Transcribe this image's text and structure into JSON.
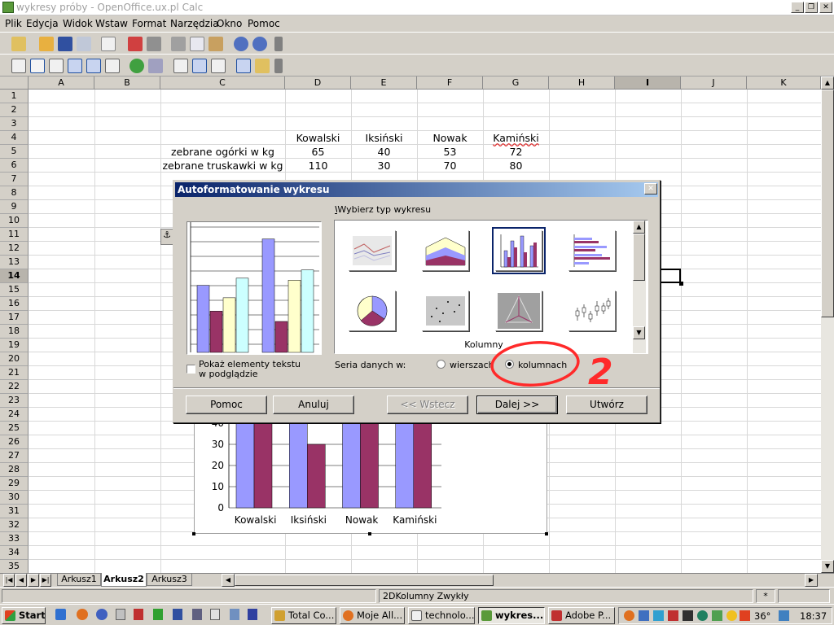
{
  "window": {
    "title": "wykresy próby - OpenOffice.ux.pl Calc"
  },
  "menu": [
    "Plik",
    "Edycja",
    "Widok",
    "Wstaw",
    "Format",
    "Narzędzia",
    "Okno",
    "Pomoc"
  ],
  "columns": [
    "A",
    "B",
    "C",
    "D",
    "E",
    "F",
    "G",
    "H",
    "I",
    "J",
    "K"
  ],
  "rows": [
    "1",
    "2",
    "3",
    "4",
    "5",
    "6",
    "7",
    "8",
    "9",
    "10",
    "11",
    "12",
    "13",
    "14",
    "15",
    "16",
    "17",
    "18",
    "19",
    "20",
    "21",
    "22",
    "23",
    "24",
    "25",
    "26",
    "27",
    "28",
    "29",
    "30",
    "31",
    "32",
    "33",
    "34",
    "35"
  ],
  "cells": {
    "d4": "Kowalski",
    "e4": "Iksiński",
    "f4": "Nowak",
    "g4": "Kamiński",
    "c5": "zebrane ogórki w kg",
    "d5": "65",
    "e5": "40",
    "f5": "53",
    "g5": "72",
    "c6": "zebrane truskawki w kg",
    "d6": "110",
    "e6": "30",
    "f6": "70",
    "g6": "80"
  },
  "dialog": {
    "title": "Autoformatowanie wykresu",
    "chart_type_label": "Wybierz typ wykresu",
    "selected_type_name": "Kolumny",
    "show_text_label": "Pokaż elementy tekstu w podglądzie",
    "series_label": "Seria danych w:",
    "rows_option": "wierszach",
    "columns_option": "kolumnach",
    "buttons": {
      "help": "Pomoc",
      "cancel": "Anuluj",
      "back": "<< Wstecz",
      "next": "Dalej >>",
      "create": "Utwórz"
    }
  },
  "annotation_text": "2",
  "sheet_tabs": [
    "Arkusz1",
    "Arkusz2",
    "Arkusz3"
  ],
  "active_tab": "Arkusz2",
  "status": {
    "chart_type": "2DKolumny Zwykły",
    "mode": "*"
  },
  "taskbar": {
    "start": "Start",
    "tasks": [
      "Total Co...",
      "Moje All...",
      "technolo...",
      "wykres...",
      "Adobe P..."
    ],
    "temperature": "36°",
    "clock": "18:37"
  },
  "colors": {
    "series1": "#9999ff",
    "series2": "#993366",
    "series3": "#ffffcc",
    "series4": "#ccffff",
    "annotation": "#ff2a2a",
    "title_bar": "#0a246a"
  },
  "chart_data": {
    "type": "bar",
    "categories": [
      "Kowalski",
      "Iksiński",
      "Nowak",
      "Kamiński"
    ],
    "series": [
      {
        "name": "zebrane ogórki w kg",
        "values": [
          65,
          40,
          53,
          72
        ]
      },
      {
        "name": "zebrane truskawki w kg",
        "values": [
          110,
          30,
          70,
          80
        ]
      }
    ],
    "yticks": [
      0,
      10,
      20,
      30,
      40
    ],
    "ylim": [
      0,
      120
    ]
  }
}
